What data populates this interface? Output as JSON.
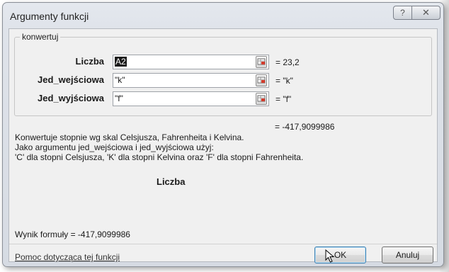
{
  "window": {
    "title": "Argumenty funkcji",
    "help_button": "?",
    "close_button": "✕"
  },
  "function_group": {
    "name": "konwertuj",
    "args": [
      {
        "label": "Liczba",
        "value": "A2",
        "result": "=  23,2"
      },
      {
        "label": "Jed_wejściowa",
        "value": "\"k\"",
        "result": "=  \"k\""
      },
      {
        "label": "Jed_wyjściowa",
        "value": "\"f\"",
        "result": "=  \"f\""
      }
    ]
  },
  "function_result": "=  -417,9099986",
  "description": {
    "line1": "Konwertuje stopnie wg skal Celsjusza, Fahrenheita i Kelvina.",
    "line2": "Jako argumentu jed_wejściowa i jed_wyjściowa użyj:",
    "line3": "'C' dla stopni Celsjusza, 'K' dla stopni Kelvina oraz 'F' dla stopni Fahrenheita.",
    "current_arg": "Liczba"
  },
  "formula_result": "Wynik formuły =   -417,9099986",
  "footer": {
    "help_link": "Pomoc dotycząca tej funkcji",
    "ok_label": "OK",
    "cancel_label": "Anuluj"
  }
}
